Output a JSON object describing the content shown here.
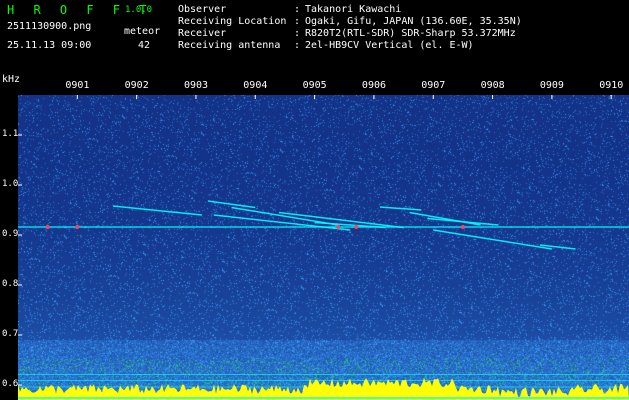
{
  "header": {
    "title": "H R O F F T",
    "version": "1.0.0",
    "filename": "2511130900.png",
    "datetime": "25.11.13 09:00",
    "meteor_label": "meteor",
    "meteor_count": "42"
  },
  "info": [
    {
      "label": "Observer",
      "value": "Takanori Kawachi"
    },
    {
      "label": "Receiving Location",
      "value": "Ogaki, Gifu, JAPAN (136.60E, 35.35N)"
    },
    {
      "label": "Receiver",
      "value": "R820T2(RTL-SDR) SDR-Sharp 53.372MHz"
    },
    {
      "label": "Receiving antenna",
      "value": "2el-HB9CV Vertical (el. E-W)"
    }
  ],
  "info_separator": ":",
  "colors": {
    "background": "#000000",
    "noise_dark": "#0a1a6e",
    "noise_light": "#3aa0ff",
    "signal": "#00ffff",
    "signal_hot": "#ff4060",
    "baseline": "#ffff00",
    "baseline_edge": "#00ffff",
    "header_green": "#00ff00",
    "text": "#ffffff"
  },
  "chart_data": {
    "type": "heatmap",
    "title": "",
    "xlabel": "",
    "ylabel": "kHz",
    "x_ticks": [
      "0901",
      "0902",
      "0903",
      "0904",
      "0905",
      "0906",
      "0907",
      "0908",
      "0909",
      "0910"
    ],
    "x_tick_minutes": [
      1,
      2,
      3,
      4,
      5,
      6,
      7,
      8,
      9,
      10
    ],
    "xlim_minutes": [
      0.0,
      10.3
    ],
    "y_ticks": [
      "1.1",
      "1.0",
      "0.9",
      "0.8",
      "0.7",
      "0.6"
    ],
    "y_tick_values": [
      1.1,
      1.0,
      0.9,
      0.8,
      0.7,
      0.6
    ],
    "ylim_khz": [
      0.57,
      1.18
    ],
    "carrier_khz": 0.916,
    "grid_lines_khz": [
      0.621,
      0.609,
      0.596
    ],
    "meteor_traces": [
      {
        "t0": 1.6,
        "t1": 3.1,
        "f0": 0.958,
        "f1": 0.94
      },
      {
        "t0": 3.2,
        "t1": 4.0,
        "f0": 0.968,
        "f1": 0.955
      },
      {
        "t0": 3.3,
        "t1": 5.6,
        "f0": 0.94,
        "f1": 0.91
      },
      {
        "t0": 3.6,
        "t1": 5.4,
        "f0": 0.955,
        "f1": 0.92
      },
      {
        "t0": 4.4,
        "t1": 6.5,
        "f0": 0.945,
        "f1": 0.915
      },
      {
        "t0": 5.0,
        "t1": 6.2,
        "f0": 0.925,
        "f1": 0.915
      },
      {
        "t0": 6.1,
        "t1": 6.8,
        "f0": 0.956,
        "f1": 0.95
      },
      {
        "t0": 6.6,
        "t1": 7.8,
        "f0": 0.945,
        "f1": 0.92
      },
      {
        "t0": 6.9,
        "t1": 8.1,
        "f0": 0.933,
        "f1": 0.92
      },
      {
        "t0": 7.0,
        "t1": 9.0,
        "f0": 0.91,
        "f1": 0.872
      },
      {
        "t0": 8.8,
        "t1": 9.4,
        "f0": 0.88,
        "f1": 0.872
      }
    ]
  }
}
